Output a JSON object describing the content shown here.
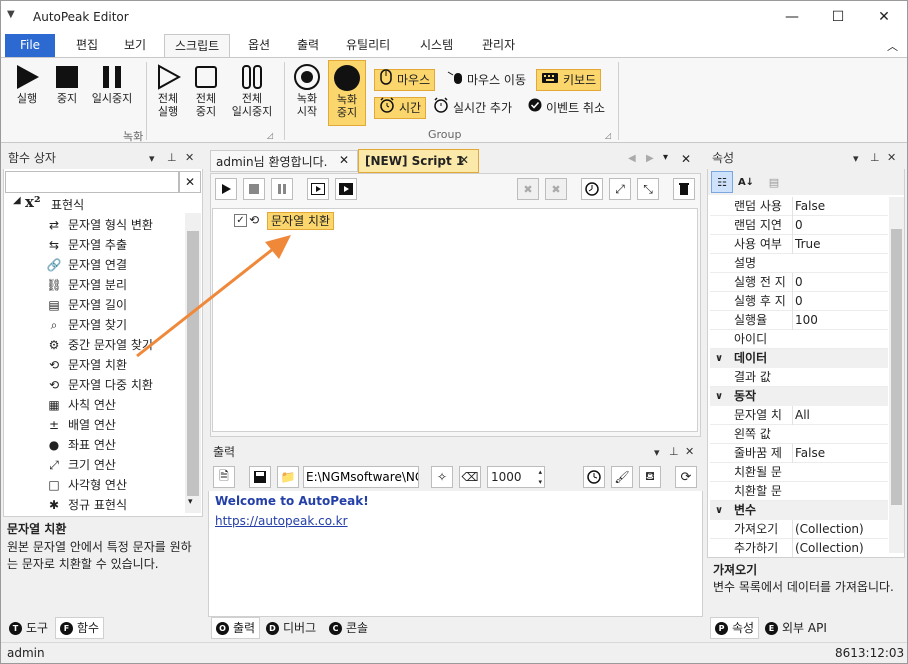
{
  "window": {
    "title": "AutoPeak Editor",
    "minimize": "—",
    "maximize": "☐",
    "close": "✕"
  },
  "ribbon_tabs": [
    "File",
    "편집",
    "보기",
    "스크립트",
    "옵션",
    "출력",
    "유틸리티",
    "시스템",
    "관리자"
  ],
  "ribbon": {
    "record_group": {
      "label": "녹화",
      "run": "실행",
      "stop": "중지",
      "pause": "일시중지",
      "run_all_1": "전체",
      "run_all_2": "실행",
      "stop_all_1": "전체",
      "stop_all_2": "중지",
      "pause_all_1": "전체",
      "pause_all_2": "일시중지"
    },
    "group2": {
      "label": "Group",
      "rec_start_1": "녹화",
      "rec_start_2": "시작",
      "rec_stop_1": "녹화",
      "rec_stop_2": "중지",
      "mouse": "마우스",
      "mouse_move": "마우스 이동",
      "keyboard": "키보드",
      "time": "시간",
      "realtime_add": "실시간 추가",
      "event_cancel": "이벤트 취소"
    }
  },
  "func_panel": {
    "title": "함수 상자",
    "search_placeholder": "",
    "category": "표현식",
    "items": [
      {
        "icon": "format-icon",
        "label": "문자열 형식 변환"
      },
      {
        "icon": "extract-icon",
        "label": "문자열 추출"
      },
      {
        "icon": "link-icon",
        "label": "문자열 연결"
      },
      {
        "icon": "split-icon",
        "label": "문자열 분리"
      },
      {
        "icon": "length-icon",
        "label": "문자열 길이"
      },
      {
        "icon": "search-icon",
        "label": "문자열 찾기"
      },
      {
        "icon": "mid-find-icon",
        "label": "중간 문자열 찾기"
      },
      {
        "icon": "replace-icon",
        "label": "문자열 치환"
      },
      {
        "icon": "multi-replace-icon",
        "label": "문자열 다중 치환"
      },
      {
        "icon": "arith-icon",
        "label": "사칙 연산"
      },
      {
        "icon": "array-icon",
        "label": "배열 연산"
      },
      {
        "icon": "coord-icon",
        "label": "좌표 연산"
      },
      {
        "icon": "size-icon",
        "label": "크기 연산"
      },
      {
        "icon": "rect-icon",
        "label": "사각형 연산"
      },
      {
        "icon": "regex-icon",
        "label": "정규 표현식"
      }
    ],
    "desc_title": "문자열 치환",
    "desc_text": "원본 문자열 안에서 특정 문자를 원하는 문자로 치환할 수 있습니다.",
    "tabs": [
      {
        "label": "도구",
        "letter": "T"
      },
      {
        "label": "함수",
        "letter": "F"
      }
    ]
  },
  "editor": {
    "tabs": [
      "admin님 환영합니다.",
      "[NEW] Script 1"
    ],
    "node_label": "문자열 치환"
  },
  "output": {
    "title": "출력",
    "path": "E:\\NGMsoftware\\NG",
    "count": "1000",
    "welcome": "Welcome to AutoPeak!",
    "link": "https://autopeak.co.kr",
    "tabs": [
      {
        "label": "출력",
        "letter": "O"
      },
      {
        "label": "디버그",
        "letter": "D"
      },
      {
        "label": "콘솔",
        "letter": "C"
      }
    ]
  },
  "props": {
    "title": "속성",
    "rows": [
      {
        "k": "랜덤 사용",
        "v": "False"
      },
      {
        "k": "랜덤 지연",
        "v": "0"
      },
      {
        "k": "사용 여부",
        "v": "True"
      },
      {
        "k": "설명",
        "v": ""
      },
      {
        "k": "실행 전 지",
        "v": "0"
      },
      {
        "k": "실행 후 지",
        "v": "0"
      },
      {
        "k": "실행율",
        "v": "100"
      },
      {
        "k": "아이디",
        "v": ""
      }
    ],
    "cat_data": "데이터",
    "data_rows": [
      {
        "k": "결과 값",
        "v": ""
      }
    ],
    "cat_action": "동작",
    "action_rows": [
      {
        "k": "문자열 치",
        "v": "All"
      },
      {
        "k": "왼쪽 값",
        "v": ""
      },
      {
        "k": "줄바꿈 제",
        "v": "False"
      },
      {
        "k": "치환될 문",
        "v": ""
      },
      {
        "k": "치환할 문",
        "v": ""
      }
    ],
    "cat_var": "변수",
    "var_rows": [
      {
        "k": "가져오기",
        "v": "(Collection)"
      },
      {
        "k": "추가하기",
        "v": "(Collection)"
      }
    ],
    "desc_title": "가져오기",
    "desc_text": "변수 목록에서 데이터를 가져옵니다.",
    "tabs": [
      {
        "label": "속성",
        "letter": "P"
      },
      {
        "label": "외부 API",
        "letter": "E"
      }
    ]
  },
  "status": {
    "user": "admin",
    "time": "8613:12:03"
  }
}
